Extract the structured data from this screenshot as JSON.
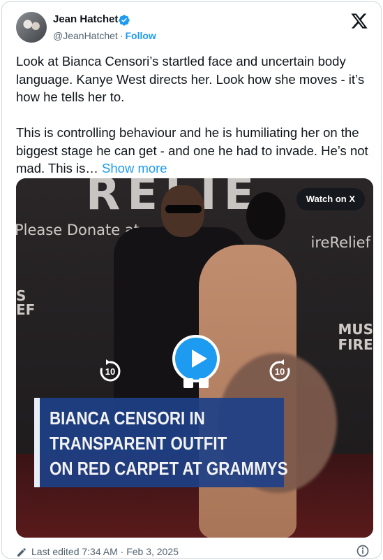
{
  "author": {
    "name": "Jean Hatchet",
    "handle": "@JeanHatchet",
    "separator": "·",
    "follow_label": "Follow"
  },
  "tweet": {
    "text": "Look at Bianca Censori’s startled face and uncertain body language. Kanye West directs her. Look how she moves - it’s how he tells her to.\n\nThis is controlling behaviour and he is humiliating her on the biggest stage he can get - and one he had to invade. He’s not mad. This is… ",
    "show_more_label": "Show more"
  },
  "media": {
    "watch_label": "Watch on X",
    "rewind_label": "10",
    "forward_label": "10",
    "backdrop_big_letters": "RELIE",
    "backdrop_text_left": "Please Donate at",
    "backdrop_text_right": "ireRelief",
    "backdrop_side_left": "S\nEF",
    "backdrop_side_right": "MUS\nFIRE",
    "caption_lines": [
      "BIANCA CENSORI IN",
      "TRANSPARENT OUTFIT",
      "ON RED CARPET AT GRAMMYS"
    ]
  },
  "footer": {
    "edited_text": "Last edited 7:34 AM · Feb 3, 2025"
  },
  "icons": {
    "verified": "verified-badge-icon",
    "brand": "x-logo-icon",
    "play": "play-icon",
    "rewind": "rewind-10-icon",
    "forward": "forward-10-icon",
    "edit": "pencil-icon",
    "info": "info-icon"
  },
  "colors": {
    "accent": "#1d9bf0",
    "caption_bg": "#1e4087"
  }
}
